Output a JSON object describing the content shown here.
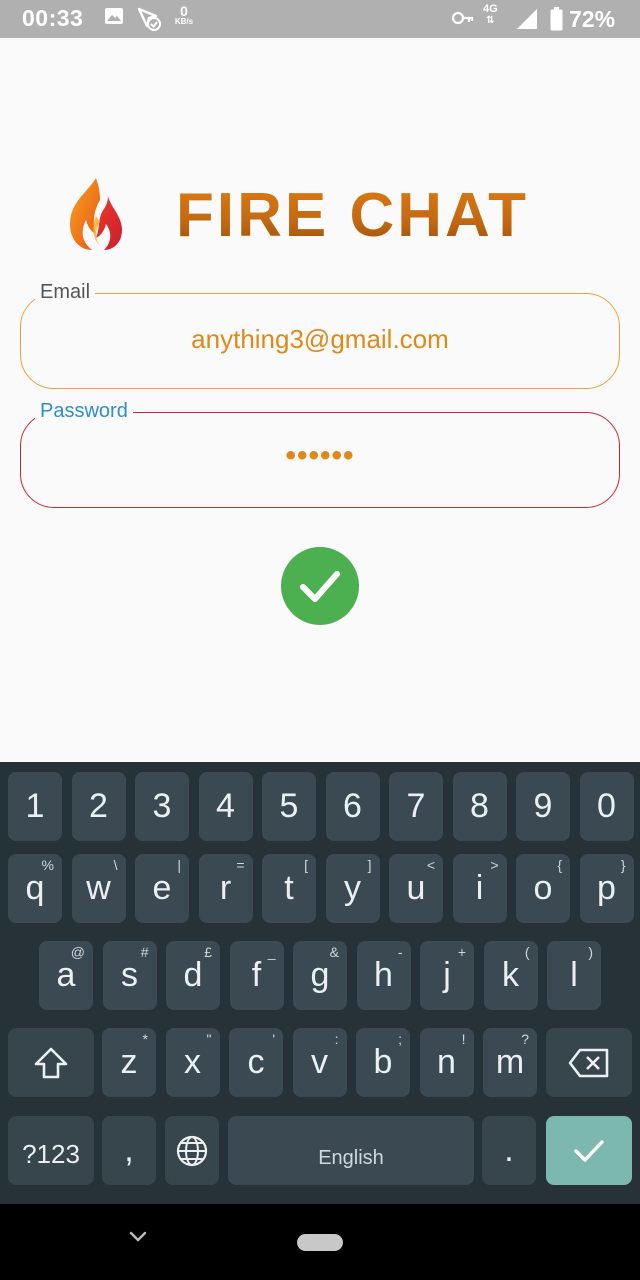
{
  "status_bar": {
    "time": "00:33",
    "data_rate_value": "0",
    "data_rate_unit": "KB/s",
    "network": "4G",
    "battery": "72%",
    "icons": [
      "image-icon",
      "no-signal-icon",
      "key-icon",
      "signal-icon",
      "battery-icon"
    ]
  },
  "app": {
    "title": "FIRE CHAT"
  },
  "form": {
    "email_label": "Email",
    "email_value": "anything3@gmail.com",
    "password_label": "Password",
    "password_value": "••••••"
  },
  "keyboard": {
    "row_numbers": [
      "1",
      "2",
      "3",
      "4",
      "5",
      "6",
      "7",
      "8",
      "9",
      "0"
    ],
    "row_q": [
      {
        "k": "q",
        "h": "%"
      },
      {
        "k": "w",
        "h": "\\"
      },
      {
        "k": "e",
        "h": "|"
      },
      {
        "k": "r",
        "h": "="
      },
      {
        "k": "t",
        "h": "["
      },
      {
        "k": "y",
        "h": "]"
      },
      {
        "k": "u",
        "h": "<"
      },
      {
        "k": "i",
        "h": ">"
      },
      {
        "k": "o",
        "h": "{"
      },
      {
        "k": "p",
        "h": "}"
      }
    ],
    "row_a": [
      {
        "k": "a",
        "h": "@"
      },
      {
        "k": "s",
        "h": "#"
      },
      {
        "k": "d",
        "h": "£"
      },
      {
        "k": "f",
        "h": "_"
      },
      {
        "k": "g",
        "h": "&"
      },
      {
        "k": "h",
        "h": "-"
      },
      {
        "k": "j",
        "h": "+"
      },
      {
        "k": "k",
        "h": "("
      },
      {
        "k": "l",
        "h": ")"
      }
    ],
    "row_z": [
      {
        "k": "z",
        "h": "*"
      },
      {
        "k": "x",
        "h": "\""
      },
      {
        "k": "c",
        "h": "'"
      },
      {
        "k": "v",
        "h": ":"
      },
      {
        "k": "b",
        "h": ";"
      },
      {
        "k": "n",
        "h": "!"
      },
      {
        "k": "m",
        "h": "?"
      }
    ],
    "symbols_label": "?123",
    "comma": ",",
    "space_label": "English",
    "period": ".",
    "accent_color": "#7db8b0"
  },
  "colors": {
    "brand_orange": "#e0891a",
    "email_border": "#e8a33a",
    "password_border": "#c8283a",
    "password_label": "#2a8fd0",
    "submit_green": "#4caf50"
  }
}
